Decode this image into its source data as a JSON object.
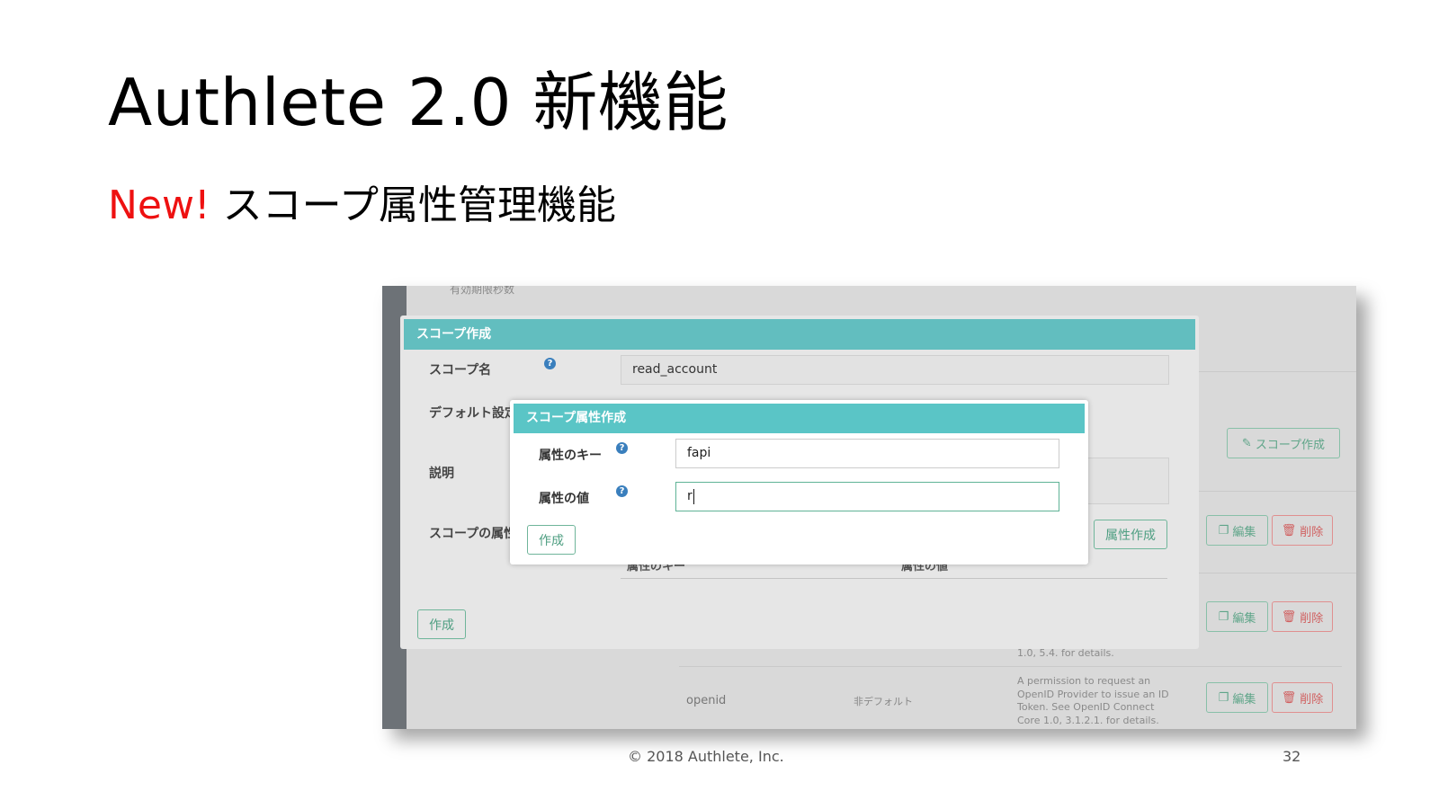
{
  "slide": {
    "title": "Authlete 2.0 新機能",
    "subtitle_new": "New!",
    "subtitle_rest": " スコープ属性管理機能",
    "footer": "© 2018 Authlete, Inc.",
    "page_number": "32"
  },
  "background": {
    "top_label": "有効期限秒数",
    "create_scope_button": "スコープ作成",
    "edit_label": "編集",
    "delete_label": "削除",
    "row_openid_name": "openid",
    "row_openid_default": "非デフォルト",
    "row_openid_desc": "A permission to request an OpenID Provider to issue an ID Token. See OpenID Connect Core 1.0, 3.1.2.1. for details.",
    "row_prev_desc_tail": "1.0, 5.4. for details."
  },
  "scope_modal": {
    "header": "スコープ作成",
    "scope_name_label": "スコープ名",
    "scope_name_value": "read_account",
    "default_label": "デフォルト設定",
    "description_label": "説明",
    "attributes_label": "スコープの属性",
    "attr_create_button": "属性作成",
    "col_key": "属性のキー",
    "col_value": "属性の値",
    "create_button": "作成"
  },
  "attr_modal": {
    "header": "スコープ属性作成",
    "key_label": "属性のキー",
    "key_value": "fapi",
    "value_label": "属性の値",
    "value_value": "r",
    "create_button": "作成"
  },
  "colors": {
    "header_teal": "#62bebf",
    "accent_green": "#5fa589",
    "delete_red": "#d06060",
    "new_red": "#ee1111"
  }
}
